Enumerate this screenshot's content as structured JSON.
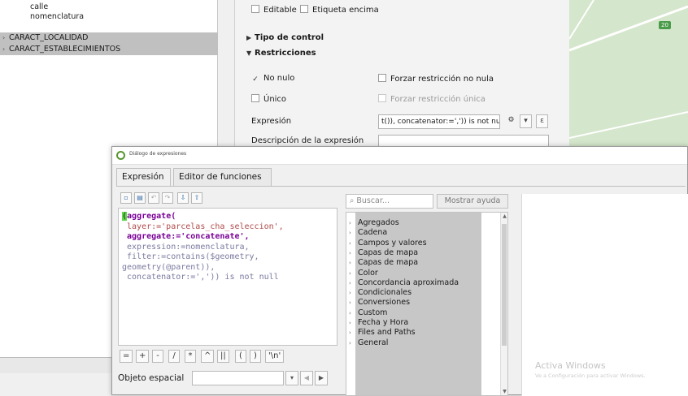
{
  "layer_tree": {
    "items": [
      {
        "label": "calle",
        "selected": false
      },
      {
        "label": "nomenclatura",
        "selected": false
      },
      {
        "label": "CARACT_LOCALIDAD",
        "selected": true
      },
      {
        "label": "CARACT_ESTABLECIMIENTOS",
        "selected": true
      }
    ]
  },
  "props": {
    "editable_label": "Editable",
    "label_on_top_label": "Etiqueta encima",
    "control_type_header": "Tipo de control",
    "restrictions_header": "Restricciones",
    "not_null_label": "No nulo",
    "force_not_null_label": "Forzar restricción no nula",
    "unique_label": "Único",
    "force_unique_label": "Forzar restricción única",
    "expression_label": "Expresión",
    "expression_value": "t()),  concatenator:=',')) is not null",
    "expression_desc_label": "Descripción de la expresión"
  },
  "map": {
    "badge_text": "20"
  },
  "dialog": {
    "title": "Diálogo de expresiones",
    "tabs": [
      {
        "label": "Expresión",
        "active": true
      },
      {
        "label": "Editor de funciones",
        "active": false
      }
    ],
    "editor_lines": [
      "aggregate(",
      " layer:='parcelas_cha_seleccion',",
      " aggregate:='concatenate',",
      " expression:=nomenclatura,",
      " filter:=contains($geometry,",
      "geometry(@parent)),",
      " concatenator:=',')) is not null"
    ],
    "operators": [
      "=",
      "+",
      "-",
      "/",
      "*",
      "^",
      "||",
      "(",
      ")",
      "'\\n'"
    ],
    "object_label": "Objeto espacial",
    "search_placeholder": "Buscar...",
    "show_help_label": "Mostrar ayuda",
    "function_groups": [
      "Agregados",
      "Cadena",
      "Campos y valores",
      "Capas de mapa",
      "Capas de mapa",
      "Color",
      "Concordancia aproximada",
      "Condicionales",
      "Conversiones",
      "Custom",
      "Fecha y Hora",
      "Files and Paths",
      "General"
    ],
    "watermark_title": "Activa Windows",
    "watermark_sub": "Ve a Configuración para activar Windows."
  },
  "colors": {
    "accent_green": "#5fd54a",
    "qgis_green": "#589632",
    "selection_gray": "#c7c7c7"
  }
}
